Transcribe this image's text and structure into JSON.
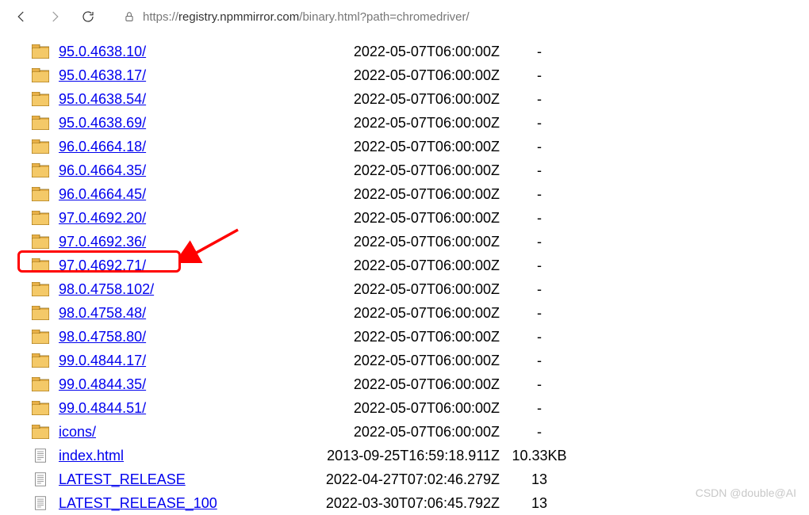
{
  "url": {
    "scheme": "https://",
    "host": "registry.npmmirror.com",
    "path": "/binary.html?path=chromedriver/"
  },
  "listing": [
    {
      "type": "folder",
      "name": "95.0.4638.10/",
      "date": "2022-05-07T06:00:00Z",
      "size": "-"
    },
    {
      "type": "folder",
      "name": "95.0.4638.17/",
      "date": "2022-05-07T06:00:00Z",
      "size": "-"
    },
    {
      "type": "folder",
      "name": "95.0.4638.54/",
      "date": "2022-05-07T06:00:00Z",
      "size": "-"
    },
    {
      "type": "folder",
      "name": "95.0.4638.69/",
      "date": "2022-05-07T06:00:00Z",
      "size": "-"
    },
    {
      "type": "folder",
      "name": "96.0.4664.18/",
      "date": "2022-05-07T06:00:00Z",
      "size": "-"
    },
    {
      "type": "folder",
      "name": "96.0.4664.35/",
      "date": "2022-05-07T06:00:00Z",
      "size": "-"
    },
    {
      "type": "folder",
      "name": "96.0.4664.45/",
      "date": "2022-05-07T06:00:00Z",
      "size": "-"
    },
    {
      "type": "folder",
      "name": "97.0.4692.20/",
      "date": "2022-05-07T06:00:00Z",
      "size": "-"
    },
    {
      "type": "folder",
      "name": "97.0.4692.36/",
      "date": "2022-05-07T06:00:00Z",
      "size": "-"
    },
    {
      "type": "folder",
      "name": "97.0.4692.71/",
      "date": "2022-05-07T06:00:00Z",
      "size": "-",
      "highlighted": true
    },
    {
      "type": "folder",
      "name": "98.0.4758.102/",
      "date": "2022-05-07T06:00:00Z",
      "size": "-"
    },
    {
      "type": "folder",
      "name": "98.0.4758.48/",
      "date": "2022-05-07T06:00:00Z",
      "size": "-"
    },
    {
      "type": "folder",
      "name": "98.0.4758.80/",
      "date": "2022-05-07T06:00:00Z",
      "size": "-"
    },
    {
      "type": "folder",
      "name": "99.0.4844.17/",
      "date": "2022-05-07T06:00:00Z",
      "size": "-"
    },
    {
      "type": "folder",
      "name": "99.0.4844.35/",
      "date": "2022-05-07T06:00:00Z",
      "size": "-"
    },
    {
      "type": "folder",
      "name": "99.0.4844.51/",
      "date": "2022-05-07T06:00:00Z",
      "size": "-"
    },
    {
      "type": "folder",
      "name": "icons/",
      "date": "2022-05-07T06:00:00Z",
      "size": "-"
    },
    {
      "type": "file",
      "name": "index.html",
      "date": "2013-09-25T16:59:18.911Z",
      "size": "10.33KB"
    },
    {
      "type": "file",
      "name": "LATEST_RELEASE",
      "date": "2022-04-27T07:02:46.279Z",
      "size": "13"
    },
    {
      "type": "file",
      "name": "LATEST_RELEASE_100",
      "date": "2022-03-30T07:06:45.792Z",
      "size": "13"
    }
  ],
  "watermark": "CSDN @double@AI"
}
